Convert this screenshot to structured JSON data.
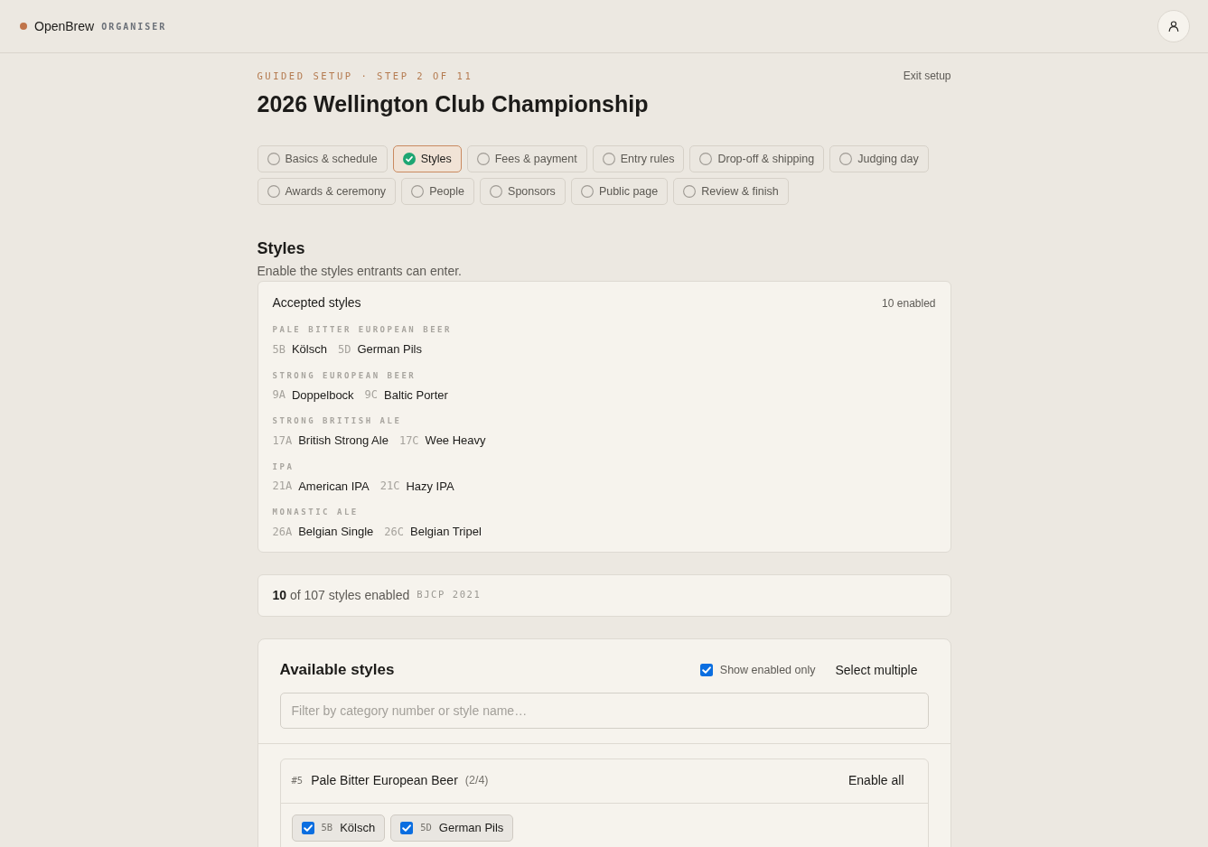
{
  "header": {
    "brand": "OpenBrew",
    "role": "ORGANISER"
  },
  "setup": {
    "eyebrow": "GUIDED SETUP · STEP 2 OF 11",
    "title": "2026 Wellington Club Championship",
    "exit": "Exit setup"
  },
  "steps": [
    {
      "label": "Basics & schedule",
      "selected": false
    },
    {
      "label": "Styles",
      "selected": true
    },
    {
      "label": "Fees & payment",
      "selected": false
    },
    {
      "label": "Entry rules",
      "selected": false
    },
    {
      "label": "Drop-off & shipping",
      "selected": false
    },
    {
      "label": "Judging day",
      "selected": false
    },
    {
      "label": "Awards & ceremony",
      "selected": false
    },
    {
      "label": "People",
      "selected": false
    },
    {
      "label": "Sponsors",
      "selected": false
    },
    {
      "label": "Public page",
      "selected": false
    },
    {
      "label": "Review & finish",
      "selected": false
    }
  ],
  "section": {
    "title": "Styles",
    "description": "Enable the styles entrants can enter."
  },
  "accepted": {
    "title": "Accepted styles",
    "count": "10 enabled",
    "groups": [
      {
        "name": "PALE BITTER EUROPEAN BEER",
        "styles": [
          {
            "code": "5B",
            "name": "Kölsch"
          },
          {
            "code": "5D",
            "name": "German Pils"
          }
        ]
      },
      {
        "name": "STRONG EUROPEAN BEER",
        "styles": [
          {
            "code": "9A",
            "name": "Doppelbock"
          },
          {
            "code": "9C",
            "name": "Baltic Porter"
          }
        ]
      },
      {
        "name": "STRONG BRITISH ALE",
        "styles": [
          {
            "code": "17A",
            "name": "British Strong Ale"
          },
          {
            "code": "17C",
            "name": "Wee Heavy"
          }
        ]
      },
      {
        "name": "IPA",
        "styles": [
          {
            "code": "21A",
            "name": "American IPA"
          },
          {
            "code": "21C",
            "name": "Hazy IPA"
          }
        ]
      },
      {
        "name": "MONASTIC ALE",
        "styles": [
          {
            "code": "26A",
            "name": "Belgian Single"
          },
          {
            "code": "26C",
            "name": "Belgian Tripel"
          }
        ]
      }
    ]
  },
  "summary": {
    "text": "**10** of 107 styles enabled",
    "guide": "BJCP 2021"
  },
  "available": {
    "title": "Available styles",
    "show_enabled_only": {
      "label": "Show enabled only",
      "checked": true
    },
    "select_multiple": "Select multiple",
    "filter": {
      "placeholder": "Filter by category number or style name…"
    },
    "categories": [
      {
        "number": "#5",
        "name": "Pale Bitter European Beer",
        "count": "(2/4)",
        "action": "Enable all",
        "styles": [
          {
            "code": "5B",
            "name": "Kölsch",
            "checked": true
          },
          {
            "code": "5D",
            "name": "German Pils",
            "checked": true
          }
        ]
      }
    ]
  }
}
